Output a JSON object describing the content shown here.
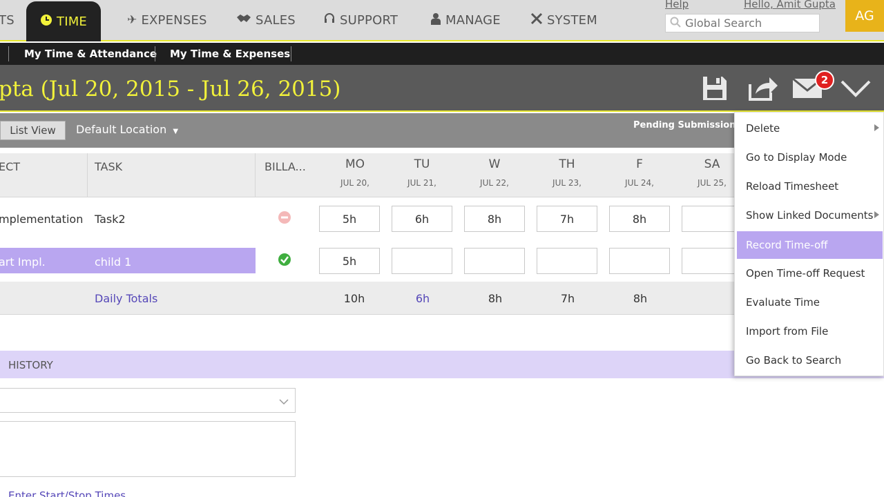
{
  "topnav": {
    "items": [
      {
        "label": "TS"
      },
      {
        "label": "TIME"
      },
      {
        "label": "EXPENSES"
      },
      {
        "label": "SALES"
      },
      {
        "label": "SUPPORT"
      },
      {
        "label": "MANAGE"
      },
      {
        "label": "SYSTEM"
      }
    ],
    "help": "Help",
    "greeting": "Hello, Amit Gupta",
    "search_placeholder": "Global Search",
    "avatar_initials": "AG",
    "accent": "#f2f23a"
  },
  "subnav": {
    "items": [
      {
        "label": "My Time & Attendance"
      },
      {
        "label": "My Time & Expenses"
      }
    ]
  },
  "titlebar": {
    "title": "pta (Jul 20, 2015 - Jul 26, 2015)",
    "notifications": "2"
  },
  "toolbar": {
    "list_view": "List View",
    "location": "Default Location",
    "status": "Pending Submission"
  },
  "grid": {
    "headers": {
      "project": "ECT",
      "task": "TASK",
      "billable": "BILLA..."
    },
    "days": [
      {
        "day": "MO",
        "date": "JUL 20,"
      },
      {
        "day": "TU",
        "date": "JUL 21,"
      },
      {
        "day": "W",
        "date": "JUL 22,"
      },
      {
        "day": "TH",
        "date": "JUL 23,"
      },
      {
        "day": "F",
        "date": "JUL 24,"
      },
      {
        "day": "SA",
        "date": "JUL 25,"
      }
    ],
    "rows": [
      {
        "project": "mplementation",
        "task": "Task2",
        "billable": "no",
        "hours": [
          "5h",
          "6h",
          "8h",
          "7h",
          "8h",
          ""
        ]
      },
      {
        "project": "art Impl.",
        "task": "child 1",
        "billable": "yes",
        "hours": [
          "5h",
          "",
          "",
          "",
          "",
          ""
        ]
      }
    ],
    "totals_label": "Daily Totals",
    "totals": [
      "10h",
      "6h",
      "8h",
      "7h",
      "8h"
    ]
  },
  "history": {
    "label": "HISTORY",
    "start_stop": "Enter Start/Stop Times"
  },
  "menu": {
    "items": [
      {
        "label": "Delete",
        "submenu": true
      },
      {
        "label": "Go to Display Mode",
        "submenu": false
      },
      {
        "label": "Reload Timesheet",
        "submenu": false
      },
      {
        "label": "Show Linked Documents",
        "submenu": true
      },
      {
        "label": "Record Time-off",
        "submenu": false,
        "highlighted": true
      },
      {
        "label": "Open Time-off Request",
        "submenu": false
      },
      {
        "label": "Evaluate Time",
        "submenu": false
      },
      {
        "label": "Import from File",
        "submenu": false
      },
      {
        "label": "Go Back to Search",
        "submenu": false
      }
    ],
    "highlight_color": "#b9a6f0"
  }
}
